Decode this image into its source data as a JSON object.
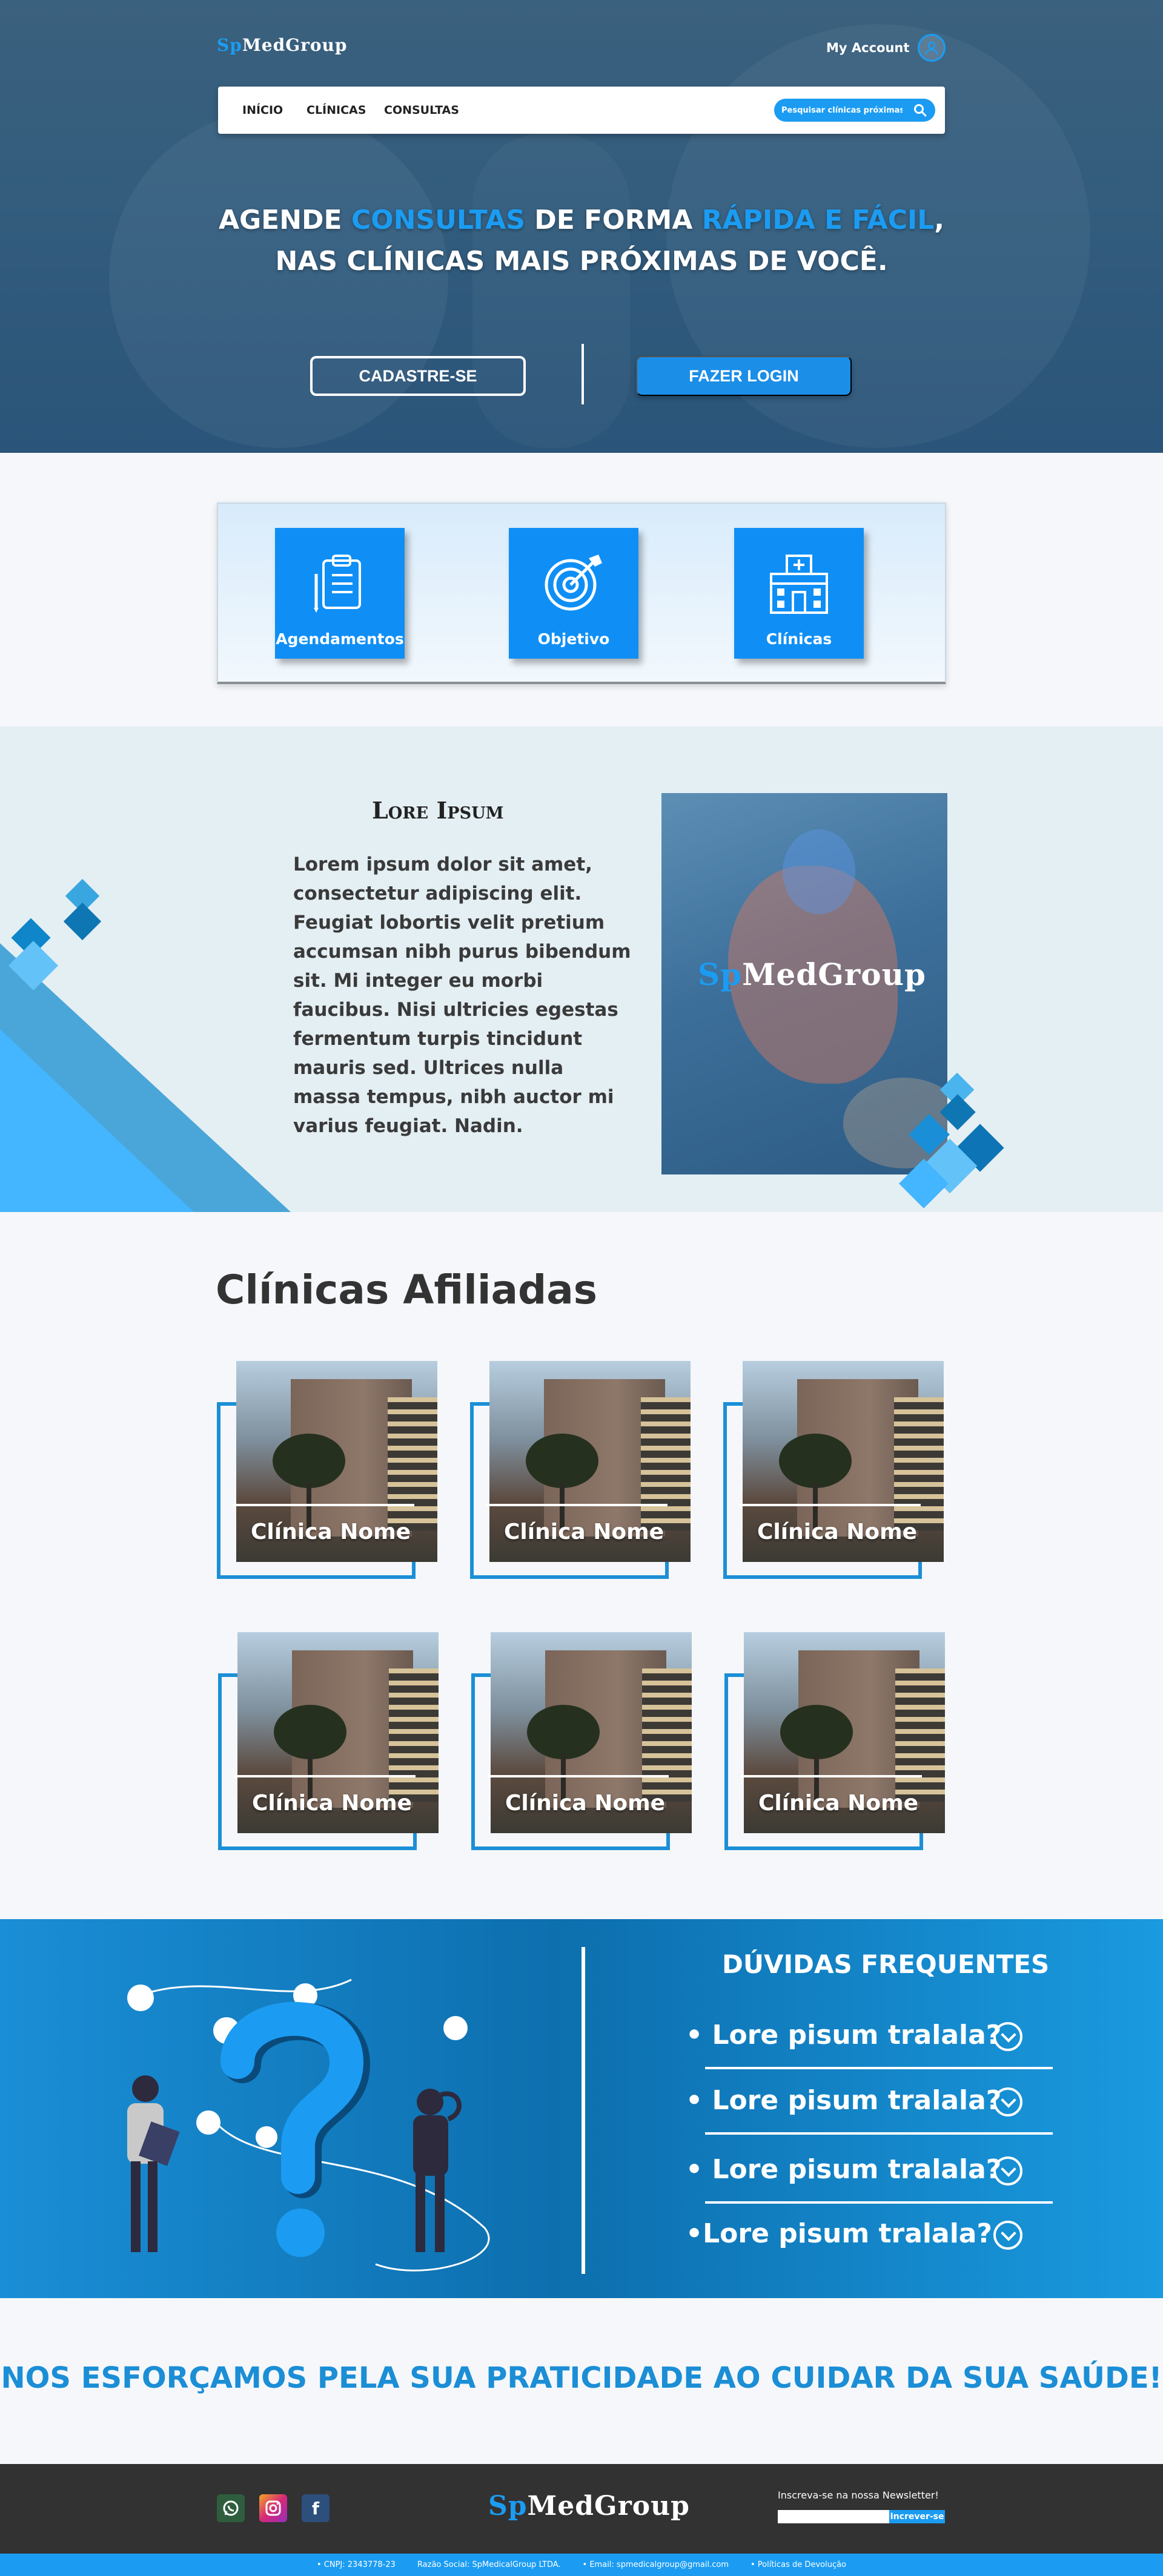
{
  "header": {
    "logo_sp": "Sp",
    "logo_rest": "MedGroup",
    "account_label": "My Account"
  },
  "nav": {
    "items": [
      "INÍCIO",
      "CLÍNICAS",
      "CONSULTAS"
    ],
    "search_placeholder": "Pesquisar clínicas próximas..."
  },
  "hero": {
    "line1_a": "AGENDE ",
    "line1_b": "CONSULTAS",
    "line1_c": " DE FORMA ",
    "line1_d": "RÁPIDA E FÁCIL",
    "line1_e": ",",
    "line2": "NAS CLÍNICAS MAIS PRÓXIMAS DE VOCÊ.",
    "cadastre_label": "CADASTRE-SE",
    "login_label": "FAZER LOGIN",
    "accent_color": "#1b9cf2"
  },
  "features": [
    {
      "label": "Agendamentos",
      "icon": "clipboard-icon"
    },
    {
      "label": "Objetivo",
      "icon": "target-icon"
    },
    {
      "label": "Clínicas",
      "icon": "hospital-icon"
    }
  ],
  "about": {
    "title": "Lore Ipsum",
    "text": "Lorem ipsum dolor sit amet, consectetur adipiscing elit. Feugiat lobortis velit pretium accumsan nibh purus bibendum sit. Mi integer eu morbi faucibus. Nisi ultricies egestas fermentum turpis tincidunt mauris sed. Ultrices nulla massa tempus, nibh auctor mi varius feugiat. Nadin.",
    "image_logo_sp": "Sp",
    "image_logo_rest": "MedGroup"
  },
  "clinics": {
    "title": "Clínicas Afiliadas",
    "items": [
      "Clínica Nome",
      "Clínica Nome",
      "Clínica Nome",
      "Clínica Nome",
      "Clínica Nome",
      "Clínica Nome"
    ]
  },
  "faq": {
    "title": "DÚVIDAS FREQUENTES",
    "questions": [
      "• Lore pisum tralala?",
      "• Lore pisum tralala?",
      "• Lore pisum tralala?",
      "•Lore pisum tralala?"
    ]
  },
  "slogan": "NOS ESFORÇAMOS PELA SUA PRATICIDADE AO CUIDAR DA SUA SAÚDE!",
  "footer": {
    "social": [
      "whatsapp-icon",
      "instagram-icon",
      "facebook-icon"
    ],
    "logo_sp": "Sp",
    "logo_rest": "MedGroup",
    "newsletter_label": "Inscreva-se na nossa Newsletter!",
    "newsletter_button": "Increver-se",
    "bottom": [
      "• CNPJ: 2343778-23",
      "Razão Social: SpMedicalGroup LTDA.",
      "• Email: spmedicalgroup@gmail.com",
      "• Políticas de Devolução"
    ]
  }
}
